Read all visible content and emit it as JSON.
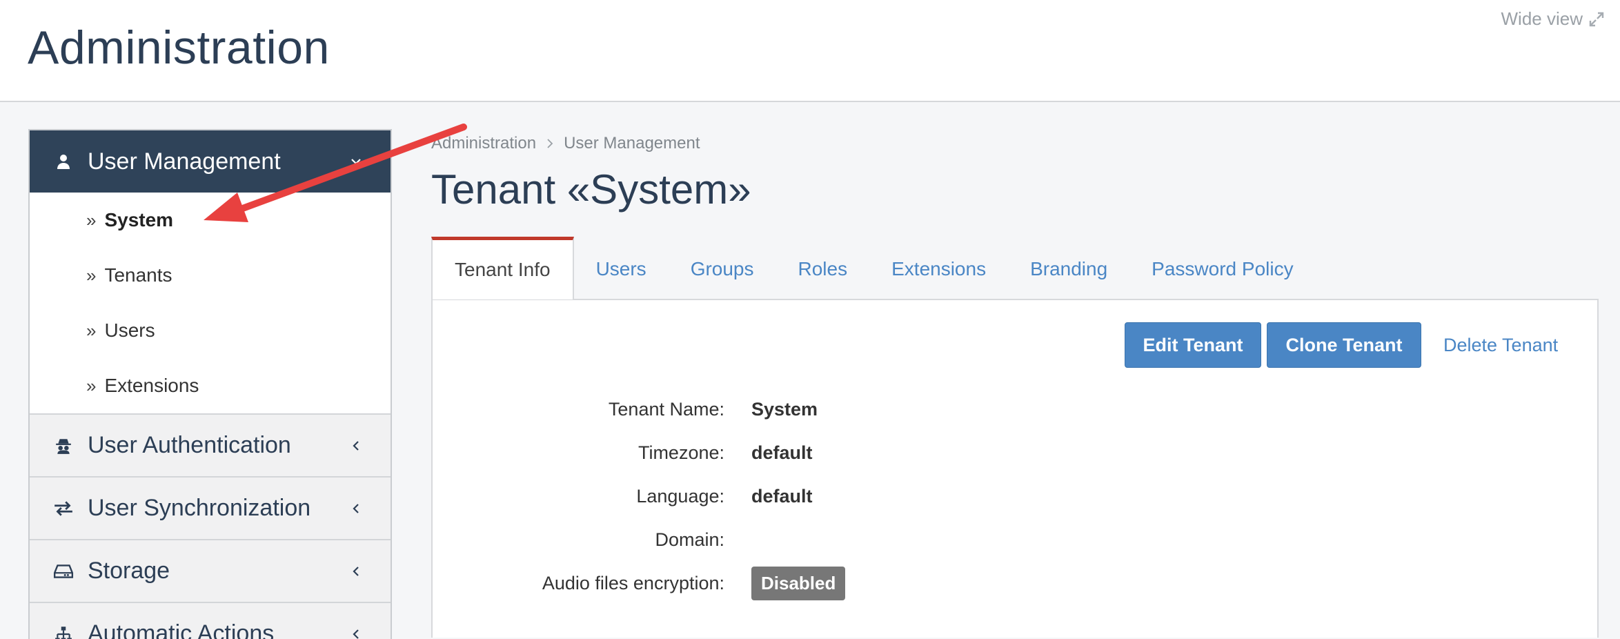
{
  "header": {
    "title": "Administration",
    "wide_view_label": "Wide view"
  },
  "sidebar": {
    "active_section": {
      "label": "User Management",
      "icon": "user-icon",
      "items": [
        {
          "label": "System",
          "selected": true
        },
        {
          "label": "Tenants",
          "selected": false
        },
        {
          "label": "Users",
          "selected": false
        },
        {
          "label": "Extensions",
          "selected": false
        }
      ]
    },
    "sections": [
      {
        "label": "User Authentication",
        "icon": "spy-icon"
      },
      {
        "label": "User Synchronization",
        "icon": "exchange-icon"
      },
      {
        "label": "Storage",
        "icon": "hdd-icon"
      },
      {
        "label": "Automatic Actions",
        "icon": "sitemap-icon"
      }
    ]
  },
  "breadcrumb": [
    "Administration",
    "User Management"
  ],
  "main": {
    "title": "Tenant «System»",
    "tabs": [
      "Tenant Info",
      "Users",
      "Groups",
      "Roles",
      "Extensions",
      "Branding",
      "Password Policy"
    ],
    "active_tab": "Tenant Info",
    "actions": {
      "edit": "Edit Tenant",
      "clone": "Clone Tenant",
      "delete": "Delete Tenant"
    },
    "fields": [
      {
        "label": "Tenant Name:",
        "value": "System"
      },
      {
        "label": "Timezone:",
        "value": "default"
      },
      {
        "label": "Language:",
        "value": "default"
      },
      {
        "label": "Domain:",
        "value": ""
      },
      {
        "label": "Audio files encryption:",
        "value": "Disabled",
        "badge": true
      }
    ]
  },
  "colors": {
    "sidebar_active": "#2f4359",
    "link": "#4a86c5",
    "tab_accent": "#c0392b",
    "annotation_arrow": "#e8413f"
  }
}
